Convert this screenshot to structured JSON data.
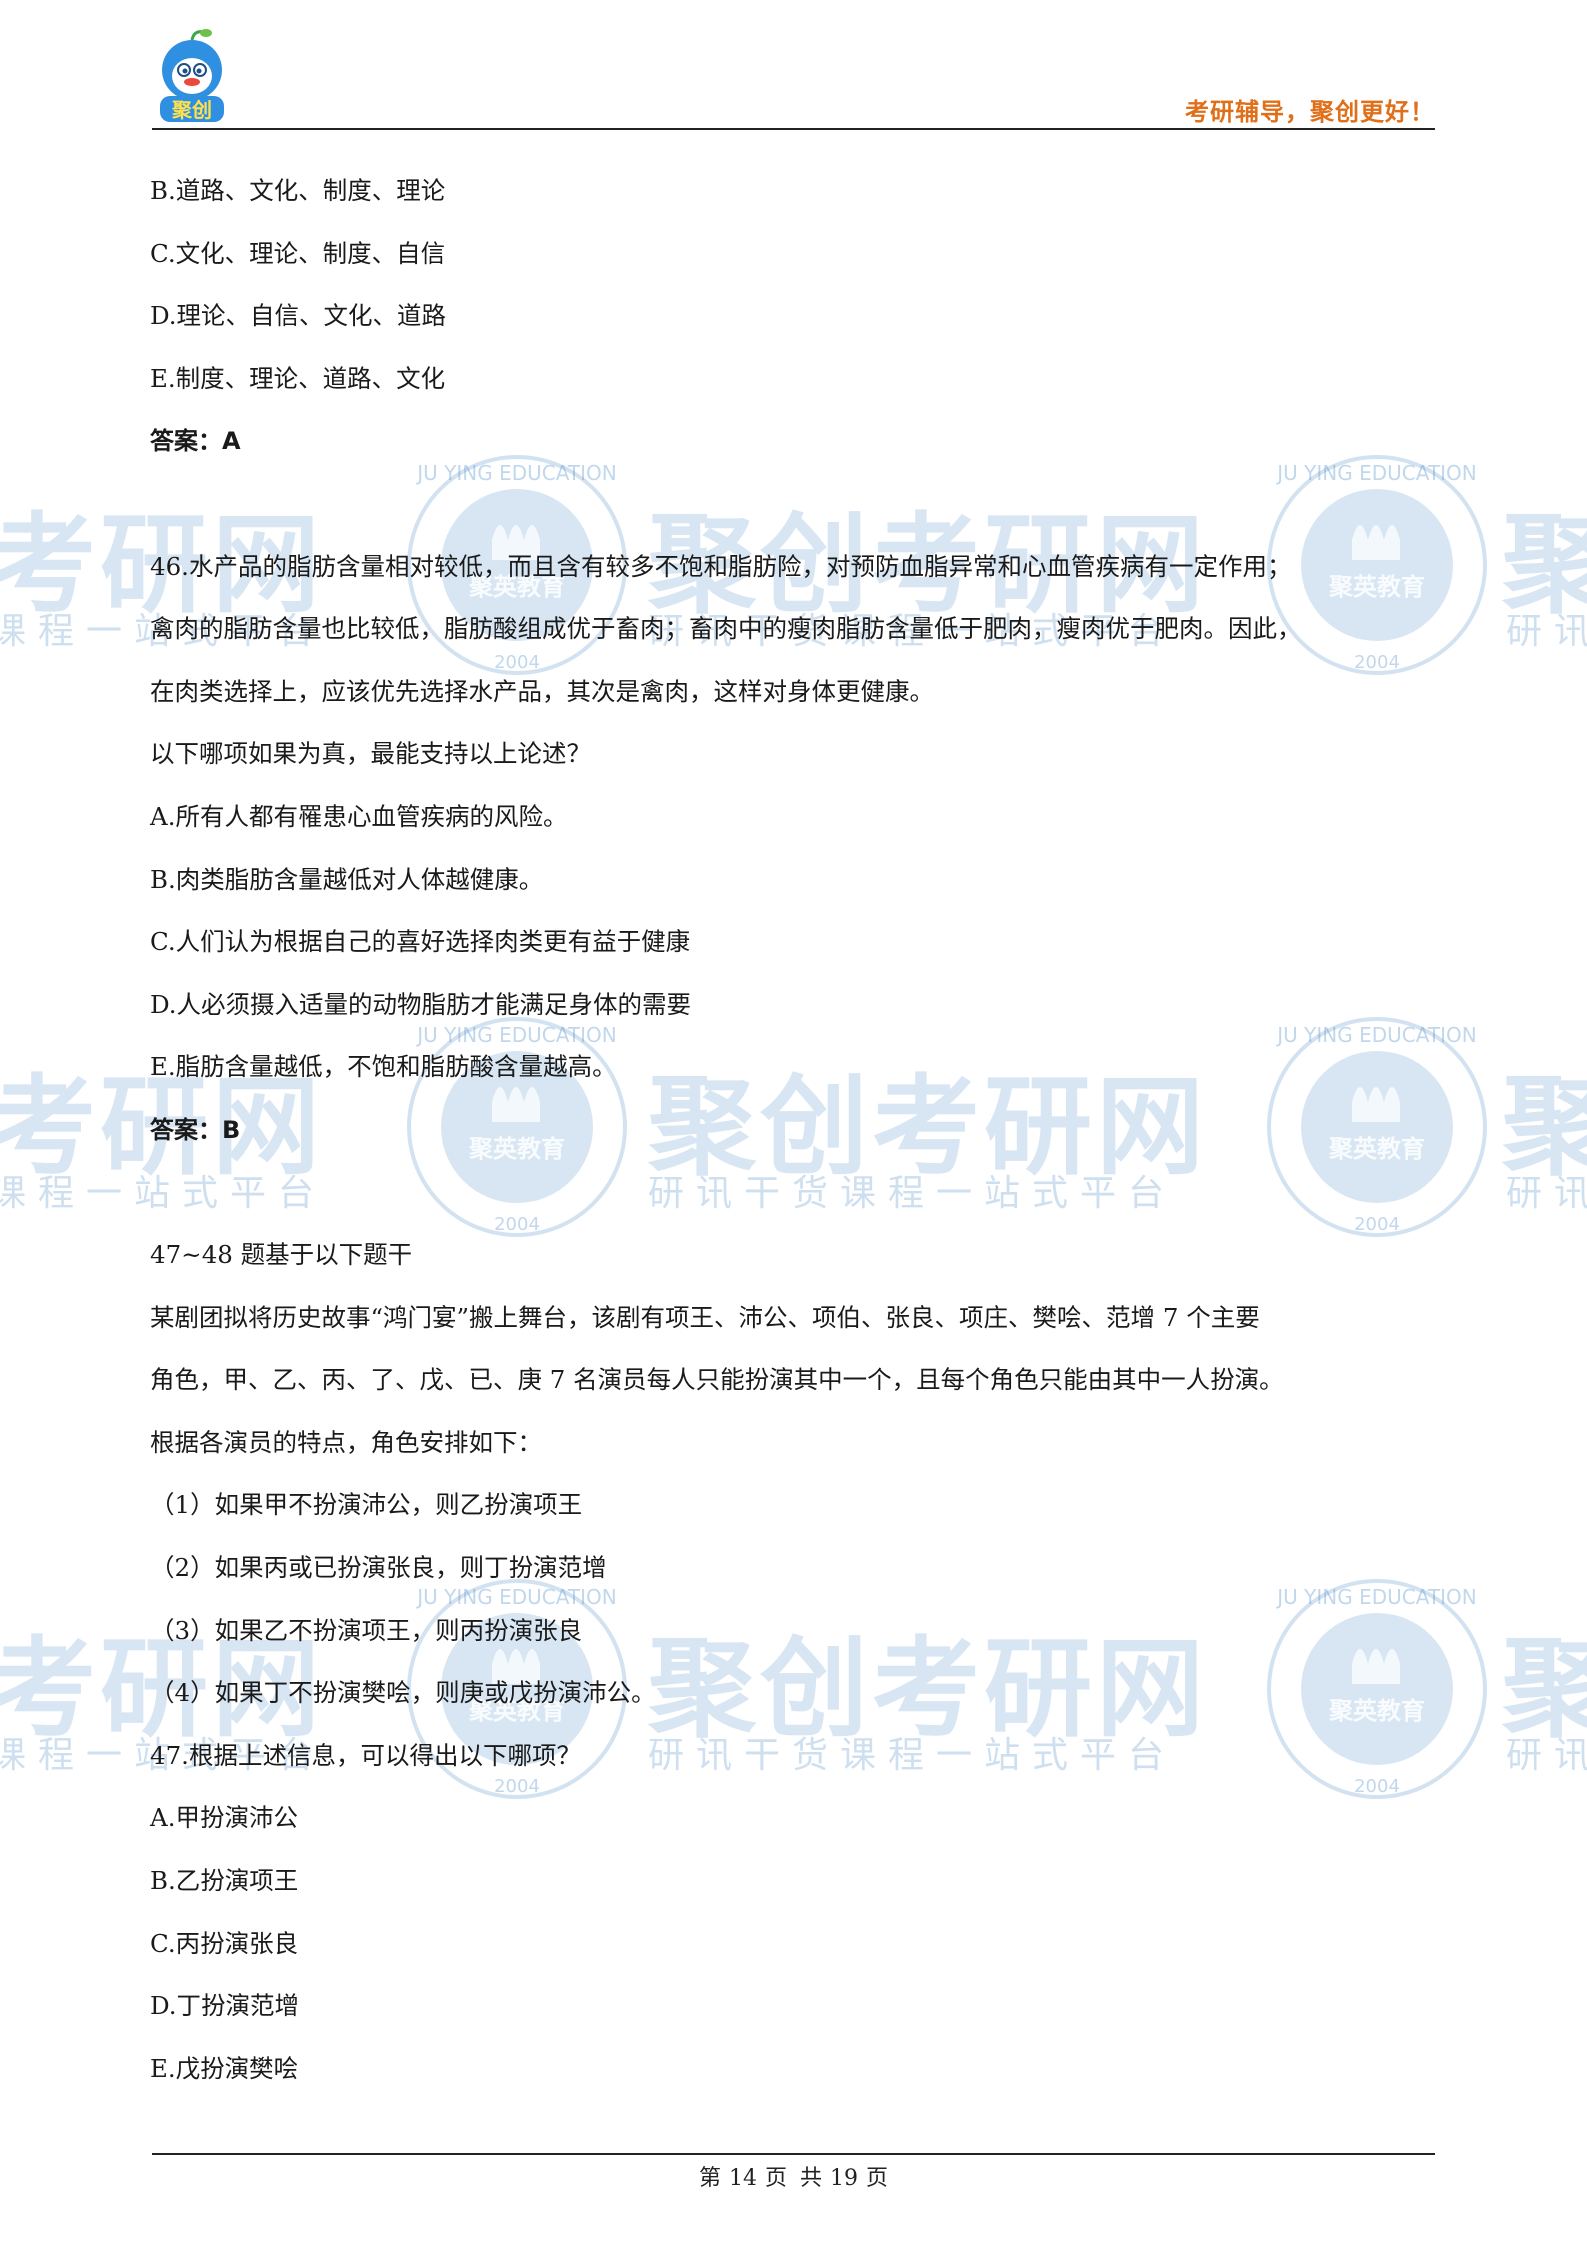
{
  "header": {
    "logo_text": "聚创",
    "slogan": "考研辅导，聚创更好！"
  },
  "watermark": {
    "brand_big_left": "考研网",
    "brand_big_center": "聚创考研网",
    "brand_big_right": "聚",
    "sub_left": "课程一站式平台",
    "sub_center": "研讯干货课程一站式平台",
    "sub_right": "研讯",
    "seal_ring": "JU YING EDUCATION",
    "seal_name": "聚英教育",
    "seal_year": "2004"
  },
  "body": {
    "lines": [
      "B.道路、文化、制度、理论",
      "C.文化、理论、制度、自信",
      "D.理论、自信、文化、道路",
      "E.制度、理论、道路、文化"
    ],
    "answer1": "答案：A",
    "q46": [
      "46.水产品的脂肪含量相对较低，而且含有较多不饱和脂肪险，对预防血脂异常和心血管疾病有一定作用；",
      "禽肉的脂肪含量也比较低，脂肪酸组成优于畜肉；畜肉中的瘦肉脂肪含量低于肥肉，瘦肉优于肥肉。因此，",
      "在肉类选择上，应该优先选择水产品，其次是禽肉，这样对身体更健康。",
      "以下哪项如果为真，最能支持以上论述？",
      "A.所有人都有罹患心血管疾病的风险。",
      "B.肉类脂肪含量越低对人体越健康。",
      "C.人们认为根据自己的喜好选择肉类更有益于健康",
      "D.人必须摄入适量的动物脂肪才能满足身体的需要",
      "E.脂肪含量越低，不饱和脂肪酸含量越高。"
    ],
    "answer2": "答案：B",
    "q47": [
      "47~48 题基于以下题干",
      "某剧团拟将历史故事“鸿门宴”搬上舞台，该剧有项王、沛公、项伯、张良、项庄、樊哙、范增 7 个主要",
      "角色，甲、乙、丙、了、戊、已、庚 7 名演员每人只能扮演其中一个，且每个角色只能由其中一人扮演。",
      "根据各演员的特点，角色安排如下：",
      "（1）如果甲不扮演沛公，则乙扮演项王",
      "（2）如果丙或已扮演张良，则丁扮演范增",
      "（3）如果乙不扮演项王，则丙扮演张良",
      "（4）如果丁不扮演樊哙，则庚或戊扮演沛公。",
      "47.根据上述信息，可以得出以下哪项？",
      "A.甲扮演沛公",
      "B.乙扮演项王",
      "C.丙扮演张良",
      "D.丁扮演范增",
      "E.戊扮演樊哙"
    ]
  },
  "footer": {
    "page_prefix": "第",
    "page_number": "14",
    "page_mid": "页 共",
    "page_total": "19",
    "page_suffix": "页"
  }
}
